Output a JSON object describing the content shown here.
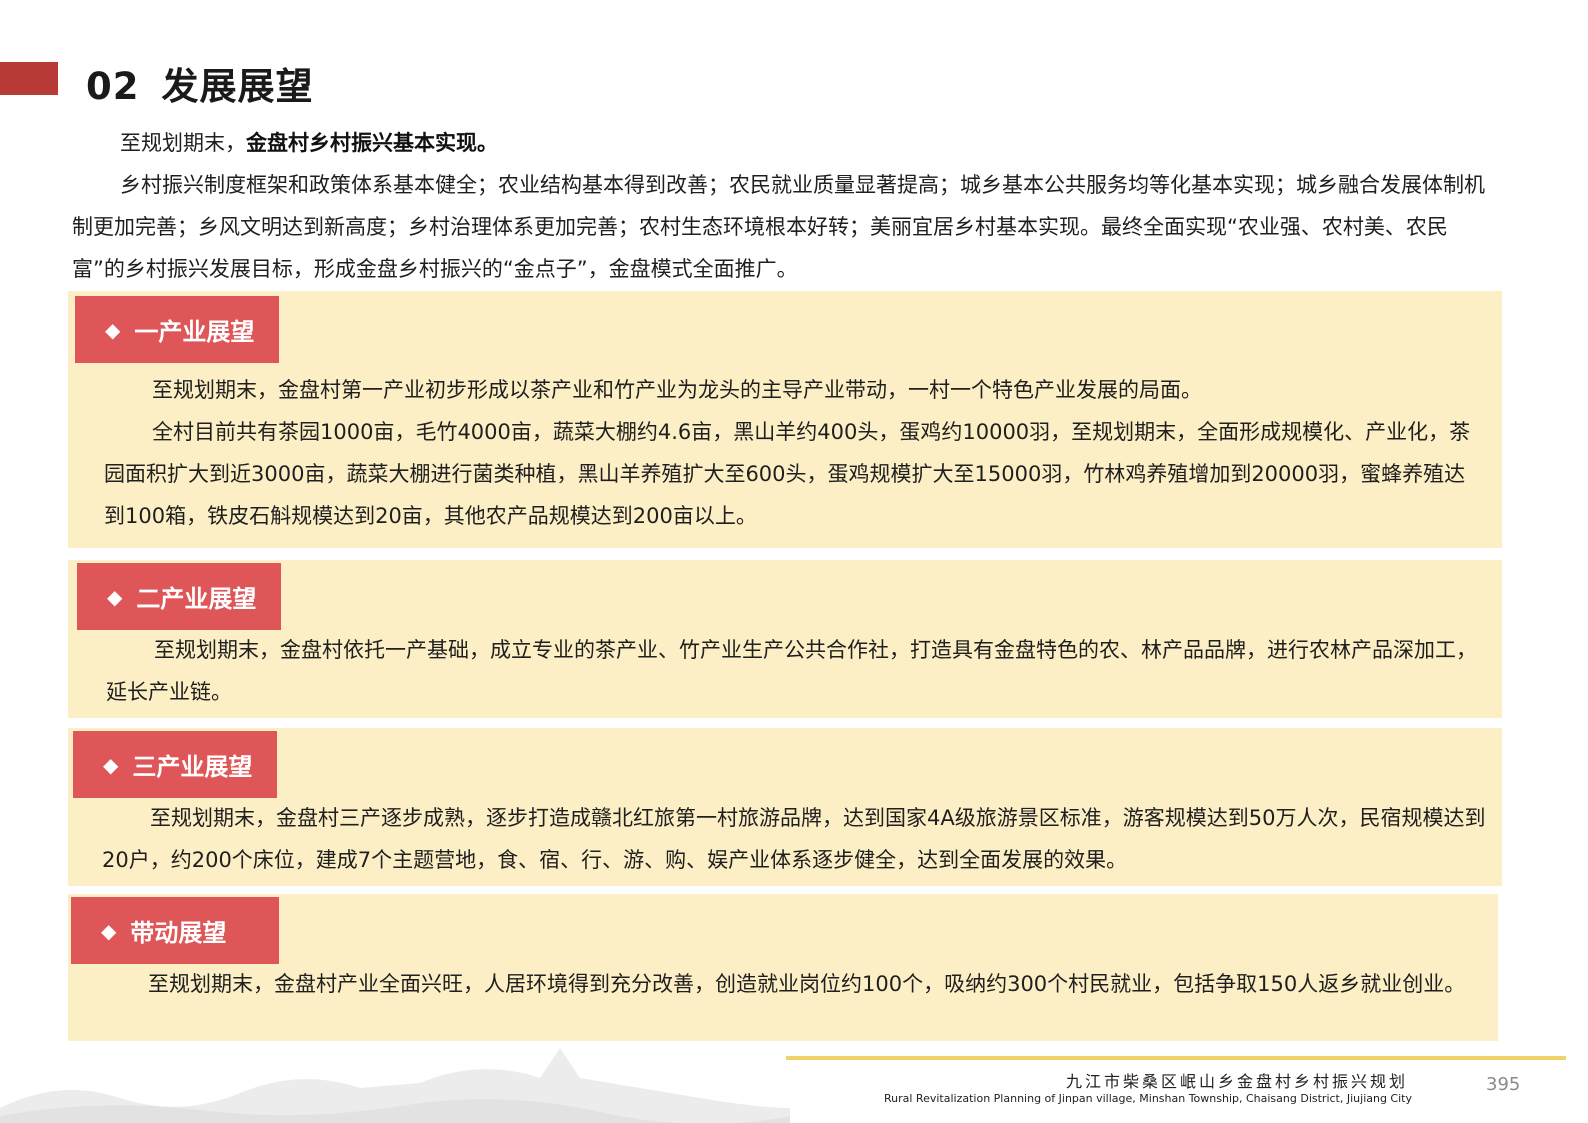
{
  "header": {
    "number": "02",
    "title": "发展展望"
  },
  "intro": {
    "lead_plain": "至规划期末，",
    "lead_bold": "金盘村乡村振兴基本实现。",
    "paragraph": "乡村振兴制度框架和政策体系基本健全；农业结构基本得到改善；农民就业质量显著提高；城乡基本公共服务均等化基本实现；城乡融合发展体制机制更加完善；乡风文明达到新高度；乡村治理体系更加完善；农村生态环境根本好转；美丽宜居乡村基本实现。最终全面实现“农业强、农村美、农民富”的乡村振兴发展目标，形成金盘乡村振兴的“金点子”，金盘模式全面推广。"
  },
  "sections": [
    {
      "tag": "一产业展望",
      "paragraphs": [
        "至规划期末，金盘村第一产业初步形成以茶产业和竹产业为龙头的主导产业带动，一村一个特色产业发展的局面。",
        "全村目前共有茶园1000亩，毛竹4000亩，蔬菜大棚约4.6亩，黑山羊约400头，蛋鸡约10000羽，至规划期末，全面形成规模化、产业化，茶园面积扩大到近3000亩，蔬菜大棚进行菌类种植，黑山羊养殖扩大至600头，蛋鸡规模扩大至15000羽，竹林鸡养殖增加到20000羽，蜜蜂养殖达到100箱，铁皮石斛规模达到20亩，其他农产品规模达到200亩以上。"
      ]
    },
    {
      "tag": "二产业展望",
      "paragraphs": [
        "至规划期末，金盘村依托一产基础，成立专业的茶产业、竹产业生产公共合作社，打造具有金盘特色的农、林产品品牌，进行农林产品深加工，延长产业链。"
      ]
    },
    {
      "tag": "三产业展望",
      "paragraphs": [
        "至规划期末，金盘村三产逐步成熟，逐步打造成赣北红旅第一村旅游品牌，达到国家4A级旅游景区标准，游客规模达到50万人次，民宿规模达到20户，约200个床位，建成7个主题营地，食、宿、行、游、购、娱产业体系逐步健全，达到全面发展的效果。"
      ]
    },
    {
      "tag": "带动展望",
      "paragraphs": [
        "至规划期末，金盘村产业全面兴旺，人居环境得到充分改善，创造就业岗位约100个，吸纳约300个村民就业，包括争取150人返乡就业创业。"
      ]
    }
  ],
  "footer": {
    "title_cn": "九江市柴桑区岷山乡金盘村乡村振兴规划",
    "title_en": "Rural Revitalization Planning of Jinpan village, Minshan Township, Chaisang District, Jiujiang City",
    "page_number": "395"
  },
  "icons": {
    "tag_bullet": "diamond-icon"
  },
  "colors": {
    "accent_red": "#df5658",
    "title_bar": "#b83a37",
    "card_bg": "#fdefc5",
    "footer_line": "#f1d26a"
  }
}
